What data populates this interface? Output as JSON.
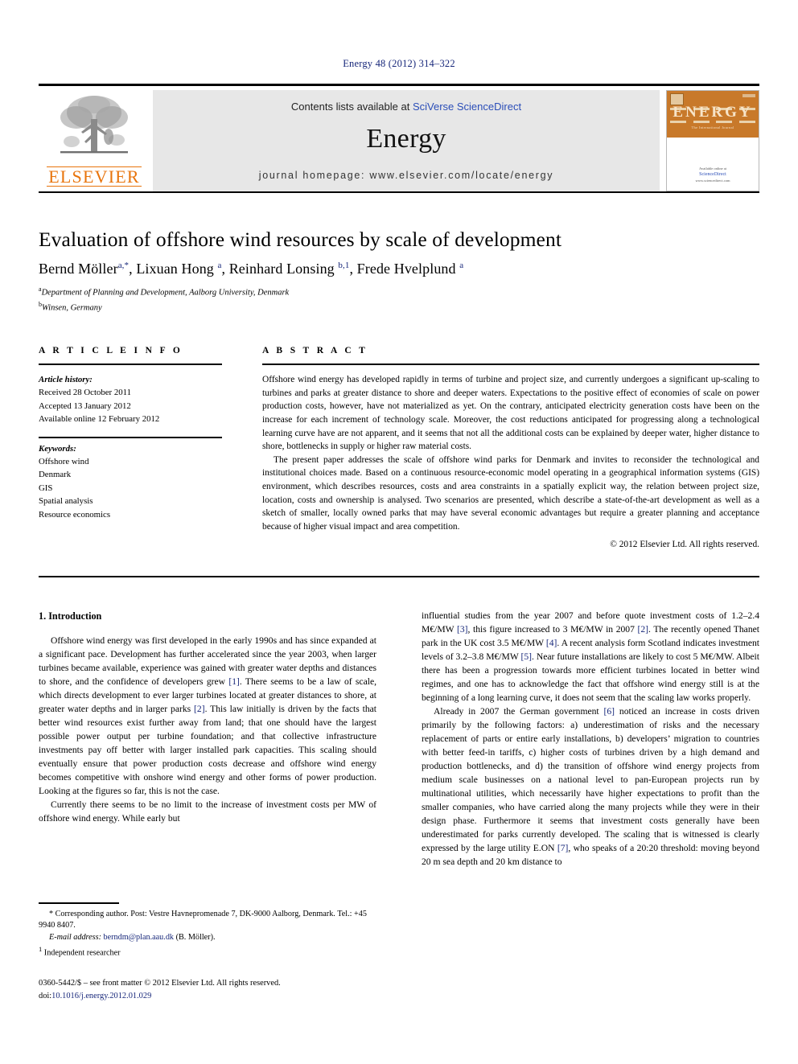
{
  "running_head": "Energy 48 (2012) 314–322",
  "header": {
    "contents_prefix": "Contents lists available at ",
    "sciencedirect": "SciVerse ScienceDirect",
    "journal_name": "Energy",
    "homepage": "journal homepage: www.elsevier.com/locate/energy",
    "publisher_logo_text": "ELSEVIER",
    "cover": {
      "title": "ENERGY",
      "subtitle": "The International Journal",
      "availability": "Available online at",
      "platform": "ScienceDirect",
      "platform_url": "www.sciencedirect.com"
    }
  },
  "article": {
    "title": "Evaluation of offshore wind resources by scale of development",
    "authors_html": "Bernd Möller<sup>a,*</sup>, Lixuan Hong <sup>a</sup>, Reinhard Lonsing <sup>b,1</sup>, Frede Hvelplund <sup>a</sup>",
    "affiliations": [
      {
        "marker": "a",
        "text": "Department of Planning and Development, Aalborg University, Denmark"
      },
      {
        "marker": "b",
        "text": "Winsen, Germany"
      }
    ]
  },
  "article_info": {
    "heading": "A R T I C L E   I N F O",
    "history_title": "Article history:",
    "history": [
      "Received 28 October 2011",
      "Accepted 13 January 2012",
      "Available online 12 February 2012"
    ],
    "keywords_title": "Keywords:",
    "keywords": [
      "Offshore wind",
      "Denmark",
      "GIS",
      "Spatial analysis",
      "Resource economics"
    ]
  },
  "abstract": {
    "heading": "A B S T R A C T",
    "paragraphs": [
      "Offshore wind energy has developed rapidly in terms of turbine and project size, and currently undergoes a significant up-scaling to turbines and parks at greater distance to shore and deeper waters. Expectations to the positive effect of economies of scale on power production costs, however, have not materialized as yet. On the contrary, anticipated electricity generation costs have been on the increase for each increment of technology scale. Moreover, the cost reductions anticipated for progressing along a technological learning curve have are not apparent, and it seems that not all the additional costs can be explained by deeper water, higher distance to shore, bottlenecks in supply or higher raw material costs.",
      "The present paper addresses the scale of offshore wind parks for Denmark and invites to reconsider the technological and institutional choices made. Based on a continuous resource-economic model operating in a geographical information systems (GIS) environment, which describes resources, costs and area constraints in a spatially explicit way, the relation between project size, location, costs and ownership is analysed. Two scenarios are presented, which describe a state-of-the-art development as well as a sketch of smaller, locally owned parks that may have several economic advantages but require a greater planning and acceptance because of higher visual impact and area competition."
    ],
    "copyright": "© 2012 Elsevier Ltd. All rights reserved."
  },
  "introduction": {
    "heading": "1. Introduction",
    "left_paragraphs": [
      "Offshore wind energy was first developed in the early 1990s and has since expanded at a significant pace. Development has further accelerated since the year 2003, when larger turbines became available, experience was gained with greater water depths and distances to shore, and the confidence of developers grew [1]. There seems to be a law of scale, which directs development to ever larger turbines located at greater distances to shore, at greater water depths and in larger parks [2]. This law initially is driven by the facts that better wind resources exist further away from land; that one should have the largest possible power output per turbine foundation; and that collective infrastructure investments pay off better with larger installed park capacities. This scaling should eventually ensure that power production costs decrease and offshore wind energy becomes competitive with onshore wind energy and other forms of power production. Looking at the figures so far, this is not the case.",
      "Currently there seems to be no limit to the increase of investment costs per MW of offshore wind energy. While early but"
    ],
    "right_paragraphs": [
      "influential studies from the year 2007 and before quote investment costs of 1.2–2.4 M€/MW [3], this figure increased to 3 M€/MW in 2007 [2]. The recently opened Thanet park in the UK cost 3.5 M€/MW [4]. A recent analysis form Scotland indicates investment levels of 3.2–3.8 M€/MW [5]. Near future installations are likely to cost 5 M€/MW. Albeit there has been a progression towards more efficient turbines located in better wind regimes, and one has to acknowledge the fact that offshore wind energy still is at the beginning of a long learning curve, it does not seem that the scaling law works properly.",
      "Already in 2007 the German government [6] noticed an increase in costs driven primarily by the following factors: a) underestimation of risks and the necessary replacement of parts or entire early installations, b) developers’ migration to countries with better feed-in tariffs, c) higher costs of turbines driven by a high demand and production bottlenecks, and d) the transition of offshore wind energy projects from medium scale businesses on a national level to pan-European projects run by multinational utilities, which necessarily have higher expectations to profit than the smaller companies, who have carried along the many projects while they were in their design phase. Furthermore it seems that investment costs generally have been underestimated for parks currently developed. The scaling that is witnessed is clearly expressed by the large utility E.ON [7], who speaks of a 20:20 threshold: moving beyond 20 m sea depth and 20 km distance to"
    ]
  },
  "footnotes": {
    "corresponding": "* Corresponding author. Post: Vestre Havnepromenade 7, DK-9000 Aalborg, Denmark. Tel.: +45 9940 8407.",
    "email_label": "E-mail address:",
    "email": "berndm@plan.aau.dk",
    "email_owner": "(B. Möller).",
    "note_marker": "1",
    "note_text": "Independent researcher",
    "imprint": "0360-5442/$ – see front matter © 2012 Elsevier Ltd. All rights reserved.",
    "doi_label": "doi:",
    "doi": "10.1016/j.energy.2012.01.029"
  },
  "colors": {
    "link": "#17277a",
    "elsevier_orange": "#e8740c",
    "panel_gray": "#e7e7e7",
    "cover_orange": "#c8792a"
  }
}
